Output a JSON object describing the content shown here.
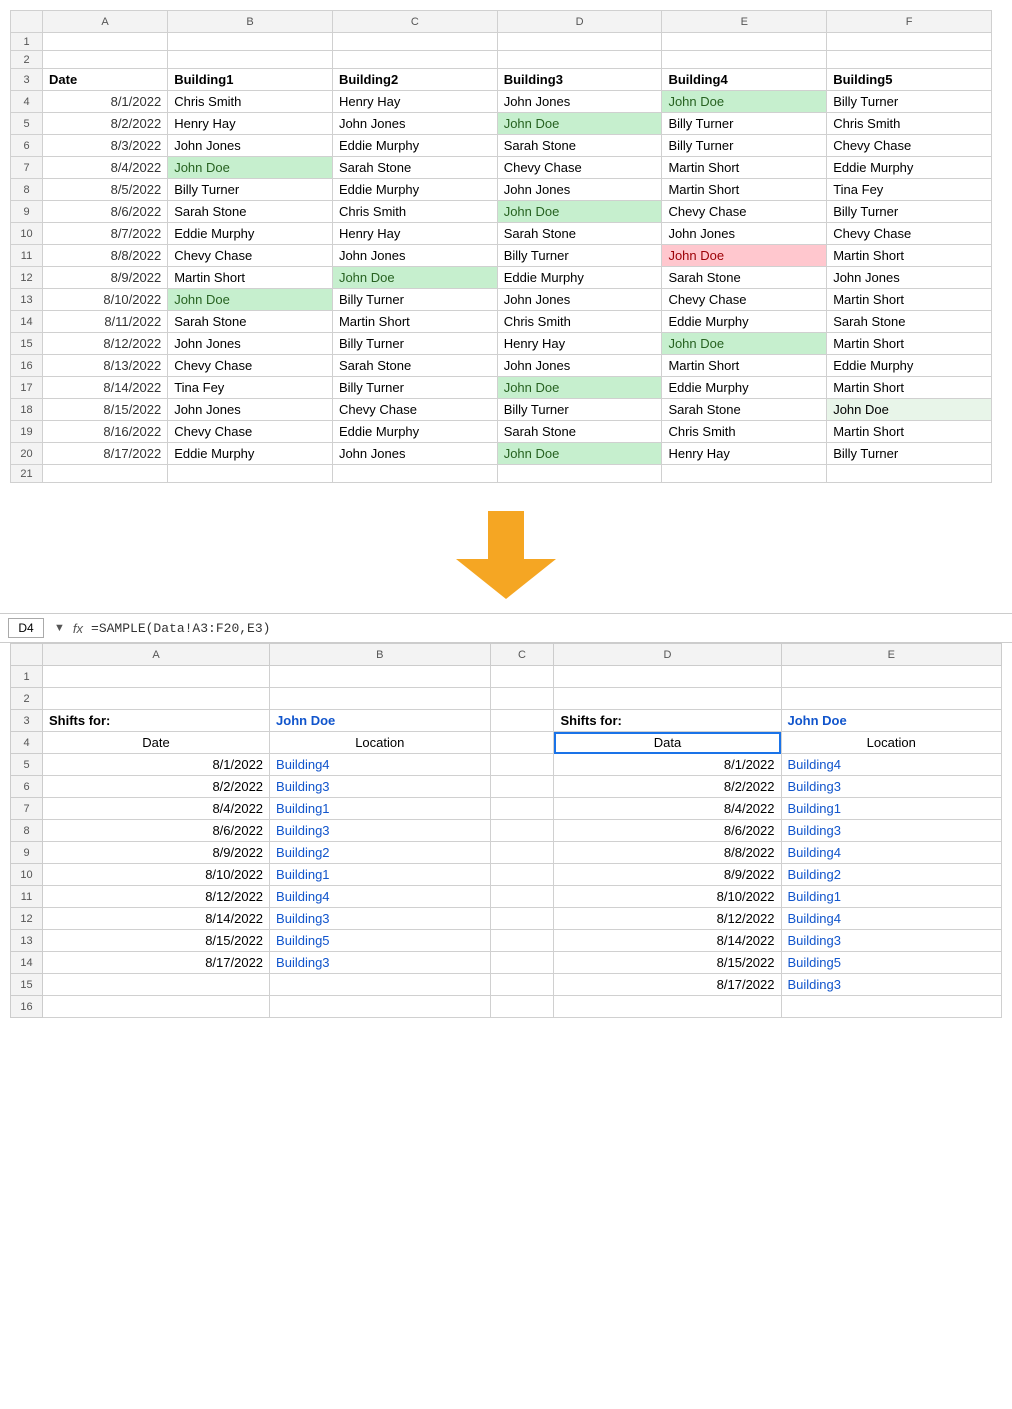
{
  "top_sheet": {
    "col_headers": [
      "",
      "A",
      "B",
      "C",
      "D",
      "E",
      "F"
    ],
    "headers_row": {
      "row_num": "3",
      "cols": [
        "Date",
        "Building1",
        "Building2",
        "Building3",
        "Building4",
        "Building5"
      ]
    },
    "rows": [
      {
        "row_num": "4",
        "date": "8/1/2022",
        "b1": "Chris Smith",
        "b2": "Henry Hay",
        "b3": "John Jones",
        "b4": "John Doe",
        "b5": "Billy Turner",
        "b1_hl": "",
        "b2_hl": "",
        "b3_hl": "",
        "b4_hl": "green",
        "b5_hl": ""
      },
      {
        "row_num": "5",
        "date": "8/2/2022",
        "b1": "Henry Hay",
        "b2": "John Jones",
        "b3": "John Doe",
        "b4": "Billy Turner",
        "b5": "Chris Smith",
        "b1_hl": "",
        "b2_hl": "",
        "b3_hl": "green",
        "b4_hl": "",
        "b5_hl": ""
      },
      {
        "row_num": "6",
        "date": "8/3/2022",
        "b1": "John Jones",
        "b2": "Eddie Murphy",
        "b3": "Sarah Stone",
        "b4": "Billy Turner",
        "b5": "Chevy Chase",
        "b1_hl": "",
        "b2_hl": "",
        "b3_hl": "",
        "b4_hl": "",
        "b5_hl": ""
      },
      {
        "row_num": "7",
        "date": "8/4/2022",
        "b1": "John Doe",
        "b2": "Sarah Stone",
        "b3": "Chevy Chase",
        "b4": "Martin Short",
        "b5": "Eddie Murphy",
        "b1_hl": "green",
        "b2_hl": "",
        "b3_hl": "",
        "b4_hl": "",
        "b5_hl": ""
      },
      {
        "row_num": "8",
        "date": "8/5/2022",
        "b1": "Billy Turner",
        "b2": "Eddie Murphy",
        "b3": "John Jones",
        "b4": "Martin Short",
        "b5": "Tina Fey",
        "b1_hl": "",
        "b2_hl": "",
        "b3_hl": "",
        "b4_hl": "",
        "b5_hl": ""
      },
      {
        "row_num": "9",
        "date": "8/6/2022",
        "b1": "Sarah Stone",
        "b2": "Chris Smith",
        "b3": "John Doe",
        "b4": "Chevy Chase",
        "b5": "Billy Turner",
        "b1_hl": "",
        "b2_hl": "",
        "b3_hl": "green",
        "b4_hl": "",
        "b5_hl": ""
      },
      {
        "row_num": "10",
        "date": "8/7/2022",
        "b1": "Eddie Murphy",
        "b2": "Henry Hay",
        "b3": "Sarah Stone",
        "b4": "John Jones",
        "b5": "Chevy Chase",
        "b1_hl": "",
        "b2_hl": "",
        "b3_hl": "",
        "b4_hl": "",
        "b5_hl": ""
      },
      {
        "row_num": "11",
        "date": "8/8/2022",
        "b1": "Chevy Chase",
        "b2": "John Jones",
        "b3": "Billy Turner",
        "b4": "John Doe",
        "b5": "Martin Short",
        "b1_hl": "",
        "b2_hl": "",
        "b3_hl": "",
        "b4_hl": "red",
        "b5_hl": ""
      },
      {
        "row_num": "12",
        "date": "8/9/2022",
        "b1": "Martin Short",
        "b2": "John Doe",
        "b3": "Eddie Murphy",
        "b4": "Sarah Stone",
        "b5": "John Jones",
        "b1_hl": "",
        "b2_hl": "green",
        "b3_hl": "",
        "b4_hl": "",
        "b5_hl": ""
      },
      {
        "row_num": "13",
        "date": "8/10/2022",
        "b1": "John Doe",
        "b2": "Billy Turner",
        "b3": "John Jones",
        "b4": "Chevy Chase",
        "b5": "Martin Short",
        "b1_hl": "green",
        "b2_hl": "",
        "b3_hl": "",
        "b4_hl": "",
        "b5_hl": ""
      },
      {
        "row_num": "14",
        "date": "8/11/2022",
        "b1": "Sarah Stone",
        "b2": "Martin Short",
        "b3": "Chris Smith",
        "b4": "Eddie Murphy",
        "b5": "Sarah Stone",
        "b1_hl": "",
        "b2_hl": "",
        "b3_hl": "",
        "b4_hl": "",
        "b5_hl": ""
      },
      {
        "row_num": "15",
        "date": "8/12/2022",
        "b1": "John Jones",
        "b2": "Billy Turner",
        "b3": "Henry Hay",
        "b4": "John Doe",
        "b5": "Martin Short",
        "b1_hl": "",
        "b2_hl": "",
        "b3_hl": "",
        "b4_hl": "green",
        "b5_hl": ""
      },
      {
        "row_num": "16",
        "date": "8/13/2022",
        "b1": "Chevy Chase",
        "b2": "Sarah Stone",
        "b3": "John Jones",
        "b4": "Martin Short",
        "b5": "Eddie Murphy",
        "b1_hl": "",
        "b2_hl": "",
        "b3_hl": "",
        "b4_hl": "",
        "b5_hl": ""
      },
      {
        "row_num": "17",
        "date": "8/14/2022",
        "b1": "Tina Fey",
        "b2": "Billy Turner",
        "b3": "John Doe",
        "b4": "Eddie Murphy",
        "b5": "Martin Short",
        "b1_hl": "",
        "b2_hl": "",
        "b3_hl": "green",
        "b4_hl": "",
        "b5_hl": ""
      },
      {
        "row_num": "18",
        "date": "8/15/2022",
        "b1": "John Jones",
        "b2": "Chevy Chase",
        "b3": "Billy Turner",
        "b4": "Sarah Stone",
        "b5": "John Doe",
        "b1_hl": "",
        "b2_hl": "",
        "b3_hl": "",
        "b4_hl": "",
        "b5_hl": "light-green"
      },
      {
        "row_num": "19",
        "date": "8/16/2022",
        "b1": "Chevy Chase",
        "b2": "Eddie Murphy",
        "b3": "Sarah Stone",
        "b4": "Chris Smith",
        "b5": "Martin Short",
        "b1_hl": "",
        "b2_hl": "",
        "b3_hl": "",
        "b4_hl": "",
        "b5_hl": ""
      },
      {
        "row_num": "20",
        "date": "8/17/2022",
        "b1": "Eddie Murphy",
        "b2": "John Jones",
        "b3": "John Doe",
        "b4": "Henry Hay",
        "b5": "Billy Turner",
        "b1_hl": "",
        "b2_hl": "",
        "b3_hl": "green",
        "b4_hl": "",
        "b5_hl": ""
      }
    ]
  },
  "formula_bar": {
    "cell_ref": "D4",
    "fx_label": "fx",
    "formula": "=SAMPLE(Data!A3:F20,E3)"
  },
  "bottom_sheet": {
    "col_headers": [
      "",
      "A",
      "B",
      "C",
      "D",
      "E"
    ],
    "left_panel": {
      "shifts_for_label": "Shifts for:",
      "name": "John Doe",
      "date_header": "Date",
      "location_header": "Location",
      "rows": [
        {
          "row_num": "5",
          "date": "8/1/2022",
          "location": "Building4"
        },
        {
          "row_num": "6",
          "date": "8/2/2022",
          "location": "Building3"
        },
        {
          "row_num": "7",
          "date": "8/4/2022",
          "location": "Building1"
        },
        {
          "row_num": "8",
          "date": "8/6/2022",
          "location": "Building3"
        },
        {
          "row_num": "9",
          "date": "8/9/2022",
          "location": "Building2"
        },
        {
          "row_num": "10",
          "date": "8/10/2022",
          "location": "Building1"
        },
        {
          "row_num": "11",
          "date": "8/12/2022",
          "location": "Building4"
        },
        {
          "row_num": "12",
          "date": "8/14/2022",
          "location": "Building3"
        },
        {
          "row_num": "13",
          "date": "8/15/2022",
          "location": "Building5"
        },
        {
          "row_num": "14",
          "date": "8/17/2022",
          "location": "Building3"
        }
      ]
    },
    "right_panel": {
      "shifts_for_label": "Shifts for:",
      "name": "John Doe",
      "date_header": "Data",
      "location_header": "Location",
      "rows": [
        {
          "row_num": "5",
          "date": "8/1/2022",
          "location": "Building4"
        },
        {
          "row_num": "6",
          "date": "8/2/2022",
          "location": "Building3"
        },
        {
          "row_num": "7",
          "date": "8/4/2022",
          "location": "Building1"
        },
        {
          "row_num": "8",
          "date": "8/6/2022",
          "location": "Building3"
        },
        {
          "row_num": "9",
          "date": "8/8/2022",
          "location": "Building4"
        },
        {
          "row_num": "10",
          "date": "8/9/2022",
          "location": "Building2"
        },
        {
          "row_num": "11",
          "date": "8/10/2022",
          "location": "Building1"
        },
        {
          "row_num": "12",
          "date": "8/12/2022",
          "location": "Building4"
        },
        {
          "row_num": "13",
          "date": "8/14/2022",
          "location": "Building3"
        },
        {
          "row_num": "14",
          "date": "8/15/2022",
          "location": "Building5"
        },
        {
          "row_num": "15",
          "date": "8/17/2022",
          "location": "Building3"
        }
      ]
    }
  }
}
